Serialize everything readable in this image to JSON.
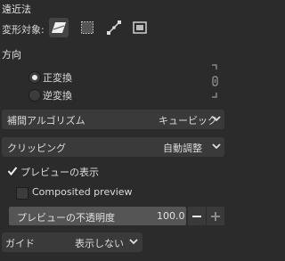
{
  "transform": {
    "section_title": "遠近法",
    "target_label": "変形対象:",
    "target_icons": [
      "layer-icon",
      "selection-icon",
      "path-icon",
      "image-icon"
    ]
  },
  "direction": {
    "title": "方向",
    "options": [
      {
        "label": "正変換",
        "checked": true
      },
      {
        "label": "逆変換",
        "checked": false
      }
    ]
  },
  "interpolation": {
    "label": "補間アルゴリズム",
    "value": "キュービック"
  },
  "clipping": {
    "label": "クリッピング",
    "value": "自動調整"
  },
  "preview": {
    "show_label": "プレビューの表示",
    "show_checked": true,
    "composited_label": "Composited preview",
    "composited_checked": false,
    "opacity_label": "プレビューの不透明度",
    "opacity_value": "100.0"
  },
  "guide": {
    "label": "ガイド",
    "value": "表示しない"
  }
}
